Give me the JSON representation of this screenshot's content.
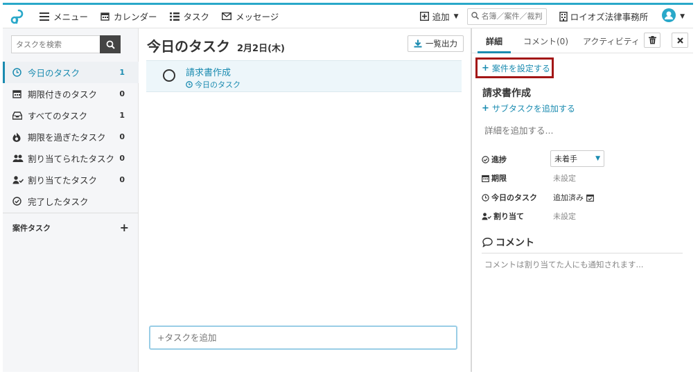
{
  "topbar": {
    "menu_label": "メニュー",
    "calendar_label": "カレンダー",
    "task_label": "タスク",
    "message_label": "メッセージ",
    "add_label": "追加",
    "search_placeholder": "名簿／案件／裁判",
    "office_name": "ロイオズ法律事務所"
  },
  "sidebar": {
    "search_placeholder": "タスクを検索",
    "items": [
      {
        "label": "今日のタスク",
        "count": "1"
      },
      {
        "label": "期限付きのタスク",
        "count": "0"
      },
      {
        "label": "すべてのタスク",
        "count": "1"
      },
      {
        "label": "期限を過ぎたタスク",
        "count": "0"
      },
      {
        "label": "割り当てられたタスク",
        "count": "0"
      },
      {
        "label": "割り当てたタスク",
        "count": "0"
      },
      {
        "label": "完了したタスク",
        "count": ""
      }
    ],
    "case_tasks_label": "案件タスク"
  },
  "main": {
    "title": "今日のタスク",
    "date": "2月2日(木)",
    "export_label": "一覧出力",
    "tasks": [
      {
        "name": "請求書作成",
        "sub": "今日のタスク"
      }
    ],
    "add_task_placeholder": "+タスクを追加"
  },
  "detail": {
    "tabs": [
      "詳細",
      "コメント(0)",
      "アクティビティ"
    ],
    "set_case_label": "案件を設定する",
    "task_title": "請求書作成",
    "add_subtask_label": "サブタスクを追加する",
    "add_detail_label": "詳細を追加する...",
    "props": {
      "progress_label": "進捗",
      "progress_value": "未着手",
      "deadline_label": "期限",
      "deadline_value": "未設定",
      "today_label": "今日のタスク",
      "today_value": "追加済み",
      "assign_label": "割り当て",
      "assign_value": "未設定"
    },
    "comment_title": "コメント",
    "comment_placeholder": "コメントは割り当てた人にも通知されます..."
  },
  "colors": {
    "accent": "#1a8bb0",
    "top_border": "#29a8c9",
    "highlight_box": "#a31616"
  }
}
